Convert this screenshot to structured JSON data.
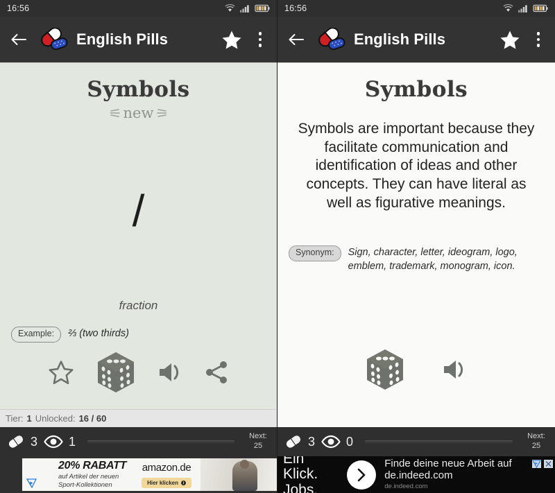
{
  "app": {
    "title": "English Pills",
    "logo_icon": "pills-icon",
    "back_icon": "back-arrow-icon",
    "favorite_icon": "star-filled-icon",
    "overflow_icon": "kebab-menu-icon"
  },
  "status_bar": {
    "clock": "16:56",
    "wifi_icon": "wifi-icon",
    "signal_icon": "cellular-signal-icon",
    "battery_icon": "battery-icon"
  },
  "left": {
    "title": "Symbols",
    "new_badge": "new",
    "symbol": "/",
    "word_label": "fraction",
    "example_chip": "Example:",
    "example_text": "⅔ (two thirds)",
    "actions": [
      {
        "name": "favorite-star-icon",
        "label": "Favorite"
      },
      {
        "name": "dice-icon",
        "label": "Random"
      },
      {
        "name": "speaker-icon",
        "label": "Pronounce"
      },
      {
        "name": "share-icon",
        "label": "Share"
      }
    ],
    "tier_label": "Tier:",
    "tier_value": "1",
    "unlocked_label": "Unlocked:",
    "unlocked_value": "16 / 60",
    "stats": {
      "pills_icon": "pill-icon",
      "pills_count": "3",
      "views_icon": "eye-icon",
      "views_count": "1",
      "progress_percent": 5,
      "next_label": "Next:",
      "next_value": "25"
    },
    "ad": {
      "network_icon": "adchoices-icon",
      "headline": "20% RABATT",
      "subline": "auf Artikel der neuen\nSport-Kollektionen",
      "brand": "amazon.de",
      "cta": "Hier klicken",
      "cta_icon": "info-icon"
    }
  },
  "right": {
    "title": "Symbols",
    "definition": "Symbols are important because they facilitate communication and identification of ideas and other concepts. They can have literal as well as figurative meanings.",
    "synonym_chip": "Synonym:",
    "synonym_text": "Sign, character, letter, ideogram, logo, emblem, trademark, monogram, icon.",
    "actions": [
      {
        "name": "dice-icon",
        "label": "Random"
      },
      {
        "name": "speaker-icon",
        "label": "Pronounce"
      }
    ],
    "stats": {
      "pills_icon": "pill-icon",
      "pills_count": "3",
      "views_icon": "eye-icon",
      "views_count": "0",
      "progress_percent": 0,
      "next_label": "Next:",
      "next_value": "25"
    },
    "ad": {
      "headline": "Ein Klick.\nJobs.",
      "arrow_icon": "chevron-right-icon",
      "main": "Finde deine neue Arbeit auf de.indeed.com",
      "url": "de.indeed.com",
      "adchoices_icon": "adchoices-icon",
      "close_icon": "close-icon"
    }
  },
  "colors": {
    "appbar": "#333333",
    "left_card": "#e2e8e0",
    "right_card": "#fafaf8",
    "icon_gray": "#6e726c",
    "progress_accent": "#4a90e2"
  }
}
